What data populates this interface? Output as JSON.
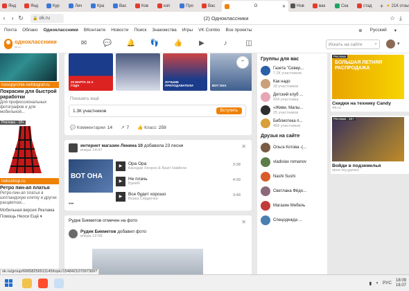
{
  "browser": {
    "tabs": [
      {
        "label": "Янд",
        "color": "#e23d2d"
      },
      {
        "label": "Янд",
        "color": "#e23d2d"
      },
      {
        "label": "Кур",
        "color": "#3a78d6"
      },
      {
        "label": "Лич",
        "color": "#3a78d6"
      },
      {
        "label": "Кра",
        "color": "#3a78d6"
      },
      {
        "label": "Вас",
        "color": "#3a78d6"
      },
      {
        "label": "Ков",
        "color": "#e23d2d"
      },
      {
        "label": "коп",
        "color": "#e23d2d"
      },
      {
        "label": "Про",
        "color": "#3a78d6"
      },
      {
        "label": "Вас",
        "color": "#e23d2d"
      }
    ],
    "active_tab": "(2) Одноклассники",
    "active_tab_short": "О",
    "after_tabs": [
      {
        "label": "Нов",
        "color": "#555555"
      },
      {
        "label": "вак",
        "color": "#e23d2d"
      },
      {
        "label": "Ска",
        "color": "#1da462"
      },
      {
        "label": "стад",
        "color": "#e23d2d"
      }
    ],
    "rating": "21К отзывов",
    "url": "ok.ru",
    "page_title": "(2) Одноклассники",
    "window_buttons": [
      "—",
      "□",
      "✕"
    ]
  },
  "bookmarks": {
    "items": [
      "Почта",
      "Облако",
      "Одноклассники",
      "ВКонтакте",
      "Новости",
      "Поиск",
      "Знакомства",
      "Игры",
      "VK Combo",
      "Все проекты"
    ],
    "language": "Русский"
  },
  "header": {
    "logo": "одноклассники",
    "logo_sub": "ok.ru",
    "icons": [
      {
        "name": "messages-icon",
        "glyph": "✉",
        "badge": "1"
      },
      {
        "name": "discussions-icon",
        "glyph": "💬",
        "badge": "2"
      },
      {
        "name": "notifications-icon",
        "glyph": "🔔",
        "badge": "4"
      },
      {
        "name": "guests-icon",
        "glyph": "👣",
        "badge": ""
      },
      {
        "name": "marks-icon",
        "glyph": "👍",
        "badge": ""
      },
      {
        "name": "video-icon",
        "glyph": "▶",
        "badge": "1"
      },
      {
        "name": "music-icon",
        "glyph": "♪",
        "badge": "1"
      },
      {
        "name": "games-icon",
        "glyph": "◫",
        "badge": ""
      }
    ],
    "search_placeholder": "Искать на сайте"
  },
  "left_ads": {
    "ad1_link": "nosopyrchik-nefdograf.ru",
    "ad1_title": "Покрасим для быстрой раработки",
    "ad1_text": "Для профессиональных фотографов и для мобильной...",
    "ad2_tag": "Реклама · 18+",
    "ad2_link": "nekoshop.ru",
    "ad2_title": "Ретро пин-ап платья",
    "ad2_text": "Ретро-пин-ап платья в шотландскую клетку и других расцветках...",
    "footer1": "Мобильная версия  Реклама",
    "footer2": "Помощь  Неоси  Ещё ▾"
  },
  "feed": {
    "card1": {
      "thumbs": [
        "20 МАРТА 44 А ГОДА",
        "",
        "ЛУЧШИЕ ПРЕПОДАВАТЕЛИ",
        "ВОТ ОНА"
      ],
      "show_more": "Показать ещё",
      "subscribers": "1.3К участников",
      "join": "Вступить",
      "comments_label": "Комментарии",
      "comments_count": "14",
      "shares_count": "7",
      "likes_label": "Класс",
      "likes_count": "259"
    },
    "card2": {
      "group": "интернет магазин Ленина 10",
      "action": "добавила 23 песни",
      "time": "вчера 14:47",
      "cover_text": "ВОТ ОНА",
      "songs": [
        {
          "title": "Ора Ора",
          "artist": "Каседаи Хеорон & Nazir Habibow",
          "duration": "3:38"
        },
        {
          "title": "Не плачь",
          "artist": "БумеR",
          "duration": "4:39"
        },
        {
          "title": "Все будет хорошо",
          "artist": "Верка Сердючка",
          "duration": "3:48"
        }
      ]
    },
    "card3": {
      "head": "Рудик Бикметов отмечен на фото",
      "name": "Рудик Бикметов",
      "action": "добавил фото",
      "time": "вчера 12:58"
    }
  },
  "groups": {
    "title": "Группы для вас",
    "items": [
      {
        "name": "Газета \"Север...",
        "members": "7.2К участников",
        "color": "#2b5fa6"
      },
      {
        "name": "Как надо",
        "members": "18 участников",
        "color": "#caa07a"
      },
      {
        "name": "Детский клуб ...",
        "members": "934 участника",
        "color": "#e7a6b5"
      },
      {
        "name": "«Живи, Малы...",
        "members": "25 участников",
        "color": "#2e2e2e"
      },
      {
        "name": "Библиотека п...",
        "members": "459 участников",
        "color": "#d8a03a"
      }
    ]
  },
  "friends": {
    "title": "Друзья на сайте",
    "items": [
      {
        "name": "Ольга Котова -(...",
        "color": "#7a5b45"
      },
      {
        "name": "vladislav romanov",
        "color": "#5b7c4a"
      },
      {
        "name": "Nashi Sushi",
        "color": "#d85c2a"
      },
      {
        "name": "Светлана Фёдо...",
        "color": "#8a6a7a"
      },
      {
        "name": "Магазин Мебель",
        "color": "#c23b3b"
      },
      {
        "name": "Спецодежда ...",
        "color": "#4a7fb0"
      }
    ]
  },
  "right_ads": [
    {
      "tag": "Реклама",
      "title": "Скидки на технику Candy",
      "src": "rbt.ru",
      "img_text": "БОЛЬШАЯ ЛЕТНЯЯ РАСПРОДАЖА"
    },
    {
      "tag": "Реклама · 18+",
      "title": "Войди в подземелья",
      "src": "store.my.games",
      "img_text": ""
    }
  ],
  "status_url": "ok.ru/group/60658256511145/topic/154842107097309?",
  "taskbar": {
    "lang": "РУС",
    "time": "18:09",
    "date": "18.07"
  }
}
